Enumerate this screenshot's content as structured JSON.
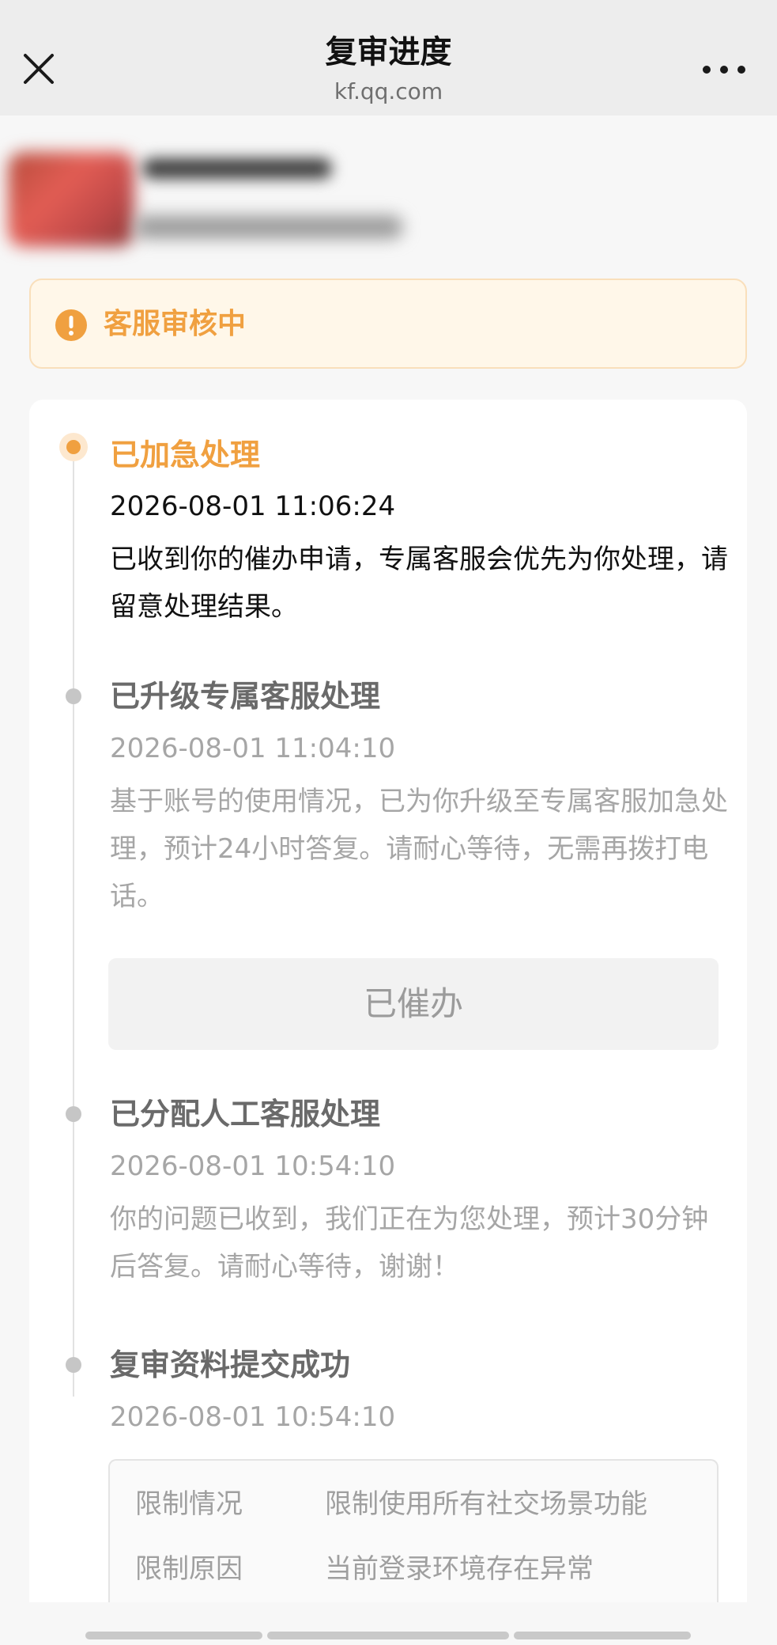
{
  "nav": {
    "title": "复审进度",
    "subtitle": "kf.qq.com"
  },
  "banner": {
    "status": "客服审核中",
    "color": "#f0a040"
  },
  "steps": [
    {
      "title": "已加急处理",
      "time": "2026-08-01 11:06:24",
      "description": "已收到你的催办申请，专属客服会优先为你处理，请留意处理结果。",
      "active": true
    },
    {
      "title": "已升级专属客服处理",
      "time": "2026-08-01 11:04:10",
      "description": "基于账号的使用情况，已为你升级至专属客服加急处理，预计24小时答复。请耐心等待，无需再拨打电话。",
      "button_label": "已催办"
    },
    {
      "title": "已分配人工客服处理",
      "time": "2026-08-01 10:54:10",
      "description": "你的问题已收到，我们正在为您处理，预计30分钟后答复。请耐心等待，谢谢！"
    },
    {
      "title": "复审资料提交成功",
      "time": "2026-08-01 10:54:10",
      "details": [
        {
          "label": "限制情况",
          "value": "限制使用所有社交场景功能"
        },
        {
          "label": "限制原因",
          "value": "当前登录环境存在异常"
        }
      ]
    }
  ],
  "icons": {
    "close": "close-icon",
    "more": "more-icon",
    "alert": "exclamation-circle-icon"
  }
}
